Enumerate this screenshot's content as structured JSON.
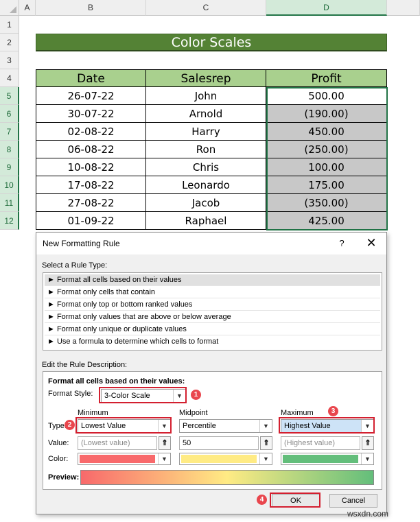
{
  "columns": [
    "A",
    "B",
    "C",
    "D"
  ],
  "rows": [
    "1",
    "2",
    "3",
    "4",
    "5",
    "6",
    "7",
    "8",
    "9",
    "10",
    "11",
    "12"
  ],
  "sheet_title": "Color Scales",
  "table": {
    "headers": {
      "date": "Date",
      "rep": "Salesrep",
      "profit": "Profit"
    },
    "rows": [
      {
        "date": "26-07-22",
        "rep": "John",
        "profit": "500.00"
      },
      {
        "date": "30-07-22",
        "rep": "Arnold",
        "profit": "(190.00)"
      },
      {
        "date": "02-08-22",
        "rep": "Harry",
        "profit": "450.00"
      },
      {
        "date": "06-08-22",
        "rep": "Ron",
        "profit": "(250.00)"
      },
      {
        "date": "10-08-22",
        "rep": "Chris",
        "profit": "100.00"
      },
      {
        "date": "17-08-22",
        "rep": "Leonardo",
        "profit": "175.00"
      },
      {
        "date": "27-08-22",
        "rep": "Jacob",
        "profit": "(350.00)"
      },
      {
        "date": "01-09-22",
        "rep": "Raphael",
        "profit": "425.00"
      }
    ]
  },
  "dialog": {
    "title": "New Formatting Rule",
    "help": "?",
    "close": "✕",
    "select_rule_type": "Select a Rule Type:",
    "rule_types": [
      "► Format all cells based on their values",
      "► Format only cells that contain",
      "► Format only top or bottom ranked values",
      "► Format only values that are above or below average",
      "► Format only unique or duplicate values",
      "► Use a formula to determine which cells to format"
    ],
    "edit_desc": "Edit the Rule Description:",
    "format_all": "Format all cells based on their values:",
    "format_style_label": "Format Style:",
    "format_style_value": "3-Color Scale",
    "min_header": "Minimum",
    "mid_header": "Midpoint",
    "max_header": "Maximum",
    "type_label": "Type:",
    "value_label": "Value:",
    "color_label": "Color:",
    "min_type": "Lowest Value",
    "mid_type": "Percentile",
    "max_type": "Highest Value",
    "min_value": "(Lowest value)",
    "mid_value": "50",
    "max_value": "(Highest value)",
    "preview_label": "Preview:",
    "ok": "OK",
    "cancel": "Cancel",
    "picker_glyph": "⇑",
    "dropdown_glyph": "▼"
  },
  "colors": {
    "min": "#f8696b",
    "mid": "#ffeb84",
    "max": "#63be7b",
    "highlight": "#d31f2f",
    "title_bg": "#548235",
    "header_bg": "#a9d08e"
  },
  "badges": [
    "1",
    "2",
    "3",
    "4"
  ],
  "watermark": "wsxdn.com"
}
